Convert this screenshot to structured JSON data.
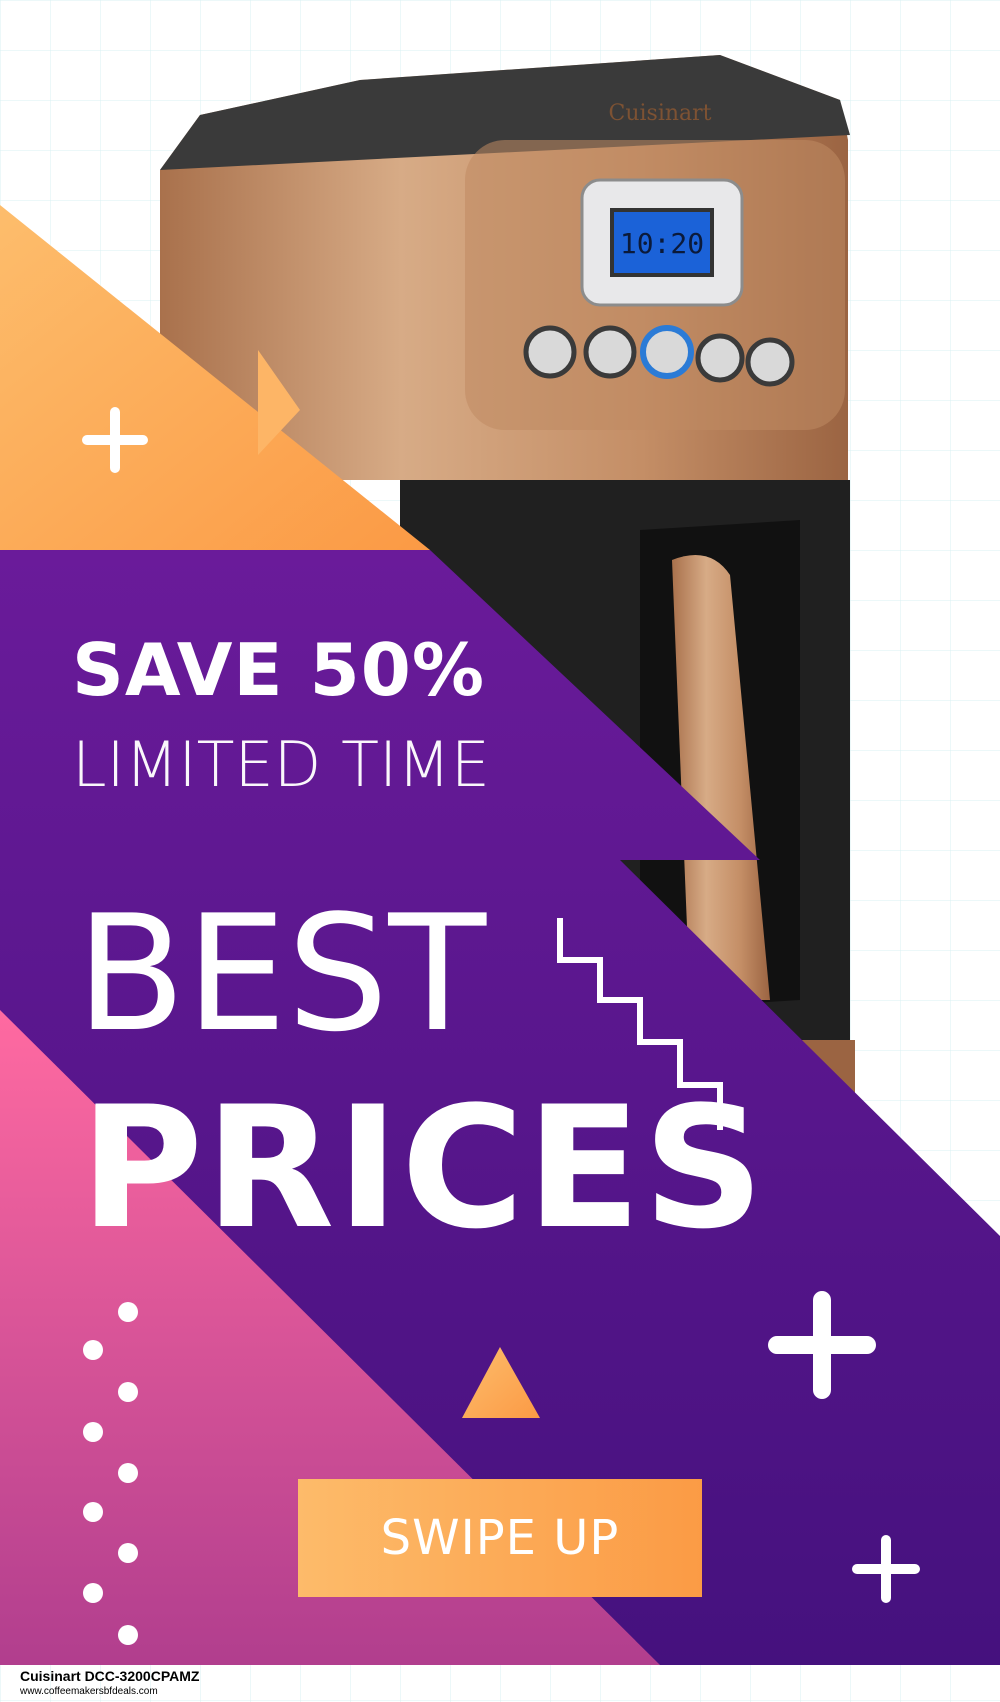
{
  "ad": {
    "line1": "SAVE 50%",
    "line2": "LIMITED TIME",
    "line3": "BEST",
    "line4": "PRICES",
    "cta_label": "SWIPE UP"
  },
  "product": {
    "lcd_time": "10:20",
    "brand_mark": "Cuisinart"
  },
  "footer": {
    "product_name": "Cuisinart DCC-3200CPAMZ",
    "site_url": "www.coffeemakersbfdeals.com"
  },
  "colors": {
    "purple_top": "#6a1b9a",
    "purple_bottom": "#45117e",
    "orange": "#fca65a",
    "pink_top": "#ff6aa1",
    "pink_bottom": "#b13e8e",
    "copper": "#c99a73"
  }
}
